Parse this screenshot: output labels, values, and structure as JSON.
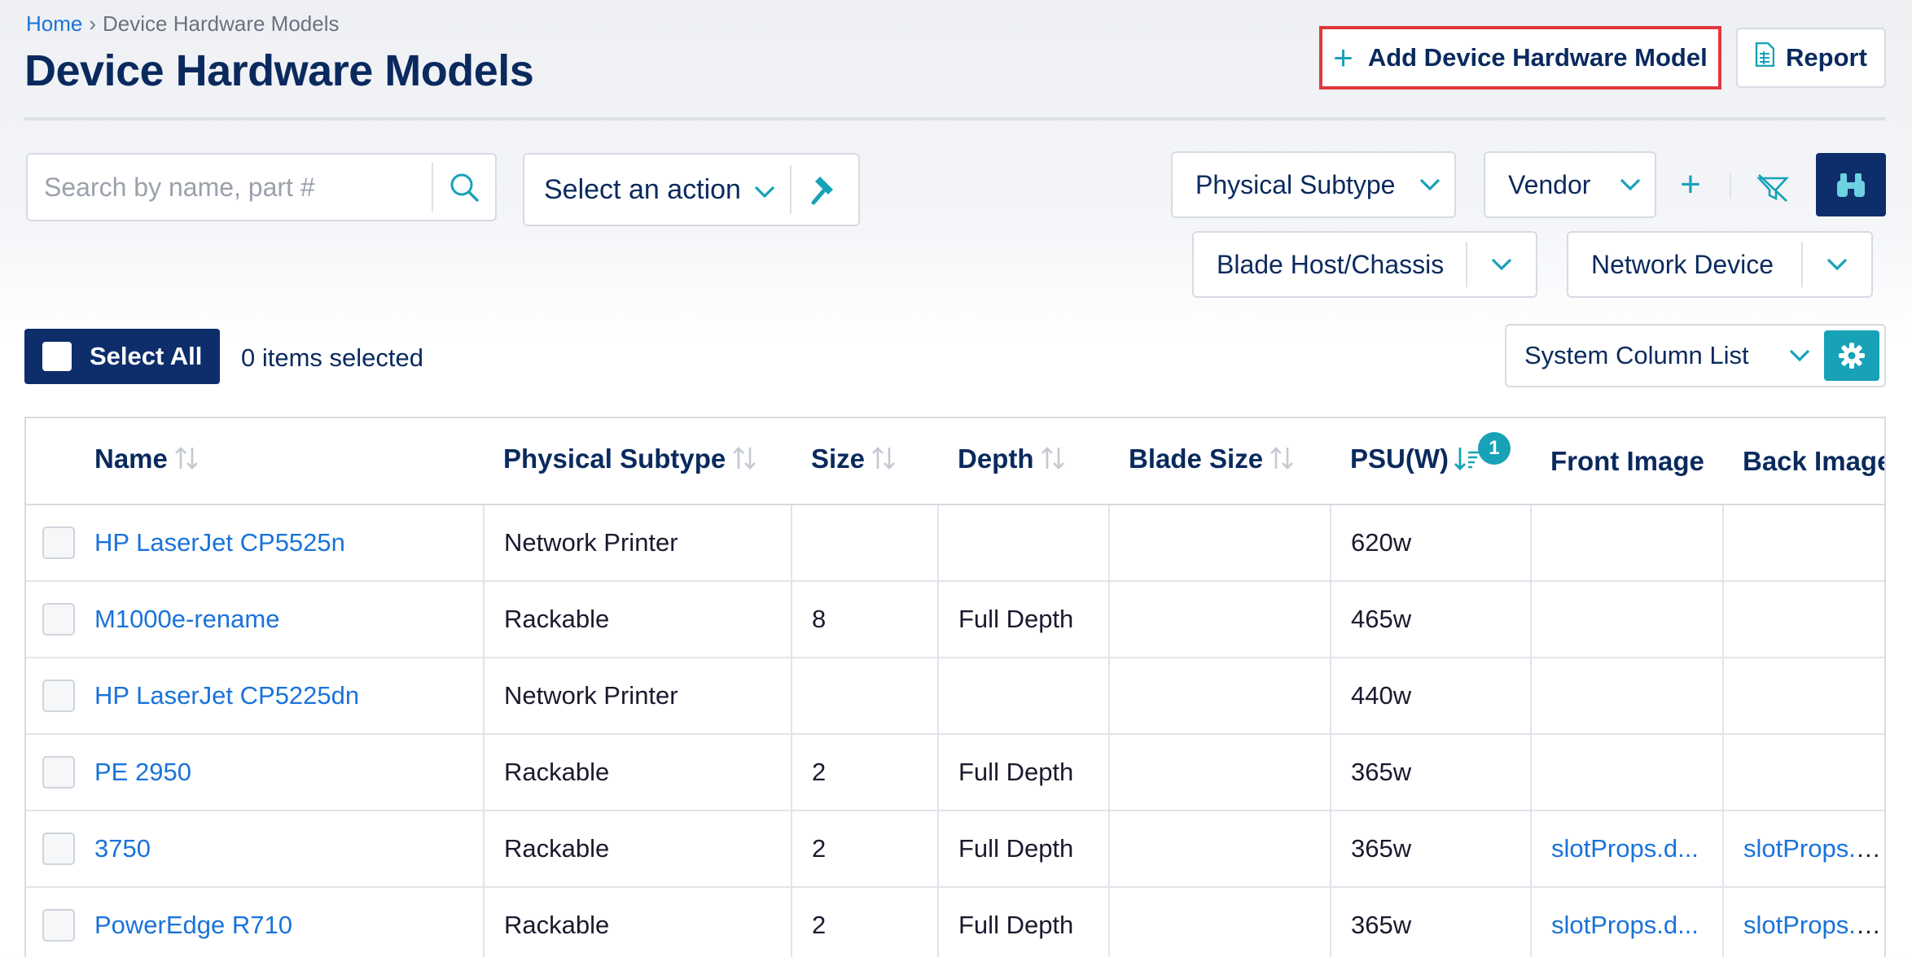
{
  "breadcrumb": {
    "home": "Home",
    "separator": "›",
    "current": "Device Hardware Models"
  },
  "page": {
    "title": "Device Hardware Models"
  },
  "header": {
    "add_label": "Add Device Hardware Model",
    "report_label": "Report"
  },
  "search": {
    "placeholder": "Search by name, part #"
  },
  "action": {
    "label": "Select an action"
  },
  "filters": {
    "physical_subtype": "Physical Subtype",
    "vendor": "Vendor",
    "blade_host": "Blade Host/Chassis",
    "network_device": "Network Device"
  },
  "selection": {
    "select_all": "Select All",
    "count_text": "0 items selected"
  },
  "column_list": {
    "label": "System Column List"
  },
  "table": {
    "headers": {
      "name": "Name",
      "physical_subtype": "Physical Subtype",
      "size": "Size",
      "depth": "Depth",
      "blade_size": "Blade Size",
      "psu": "PSU(W)",
      "psu_sort_badge": "1",
      "front_image": "Front Image",
      "back_image": "Back Image"
    },
    "rows": [
      {
        "name": "HP LaserJet CP5525n",
        "subtype": "Network Printer",
        "size": "",
        "depth": "",
        "blade_size": "",
        "psu": "620w",
        "front": "",
        "back": ""
      },
      {
        "name": "M1000e-rename",
        "subtype": "Rackable",
        "size": "8",
        "depth": "Full Depth",
        "blade_size": "",
        "psu": "465w",
        "front": "",
        "back": ""
      },
      {
        "name": "HP LaserJet CP5225dn",
        "subtype": "Network Printer",
        "size": "",
        "depth": "",
        "blade_size": "",
        "psu": "440w",
        "front": "",
        "back": ""
      },
      {
        "name": "PE 2950",
        "subtype": "Rackable",
        "size": "2",
        "depth": "Full Depth",
        "blade_size": "",
        "psu": "365w",
        "front": "",
        "back": ""
      },
      {
        "name": "3750",
        "subtype": "Rackable",
        "size": "2",
        "depth": "Full Depth",
        "blade_size": "",
        "psu": "365w",
        "front": "slotProps.d...",
        "back": "slotProps.d..."
      },
      {
        "name": "PowerEdge R710",
        "subtype": "Rackable",
        "size": "2",
        "depth": "Full Depth",
        "blade_size": "",
        "psu": "365w",
        "front": "slotProps.d...",
        "back": "slotProps.d..."
      }
    ]
  },
  "icons": {
    "search": "search-icon",
    "hammer": "hammer-icon",
    "plus": "plus-icon",
    "report": "spreadsheet-icon",
    "clear_filter": "clear-filter-icon",
    "binoculars": "binoculars-icon",
    "gear": "gear-icon",
    "chevron": "chevron-down-icon"
  },
  "colors": {
    "navy": "#0d2d6b",
    "teal": "#17a2b8",
    "link": "#1a73d9",
    "highlight": "#e0383e"
  }
}
